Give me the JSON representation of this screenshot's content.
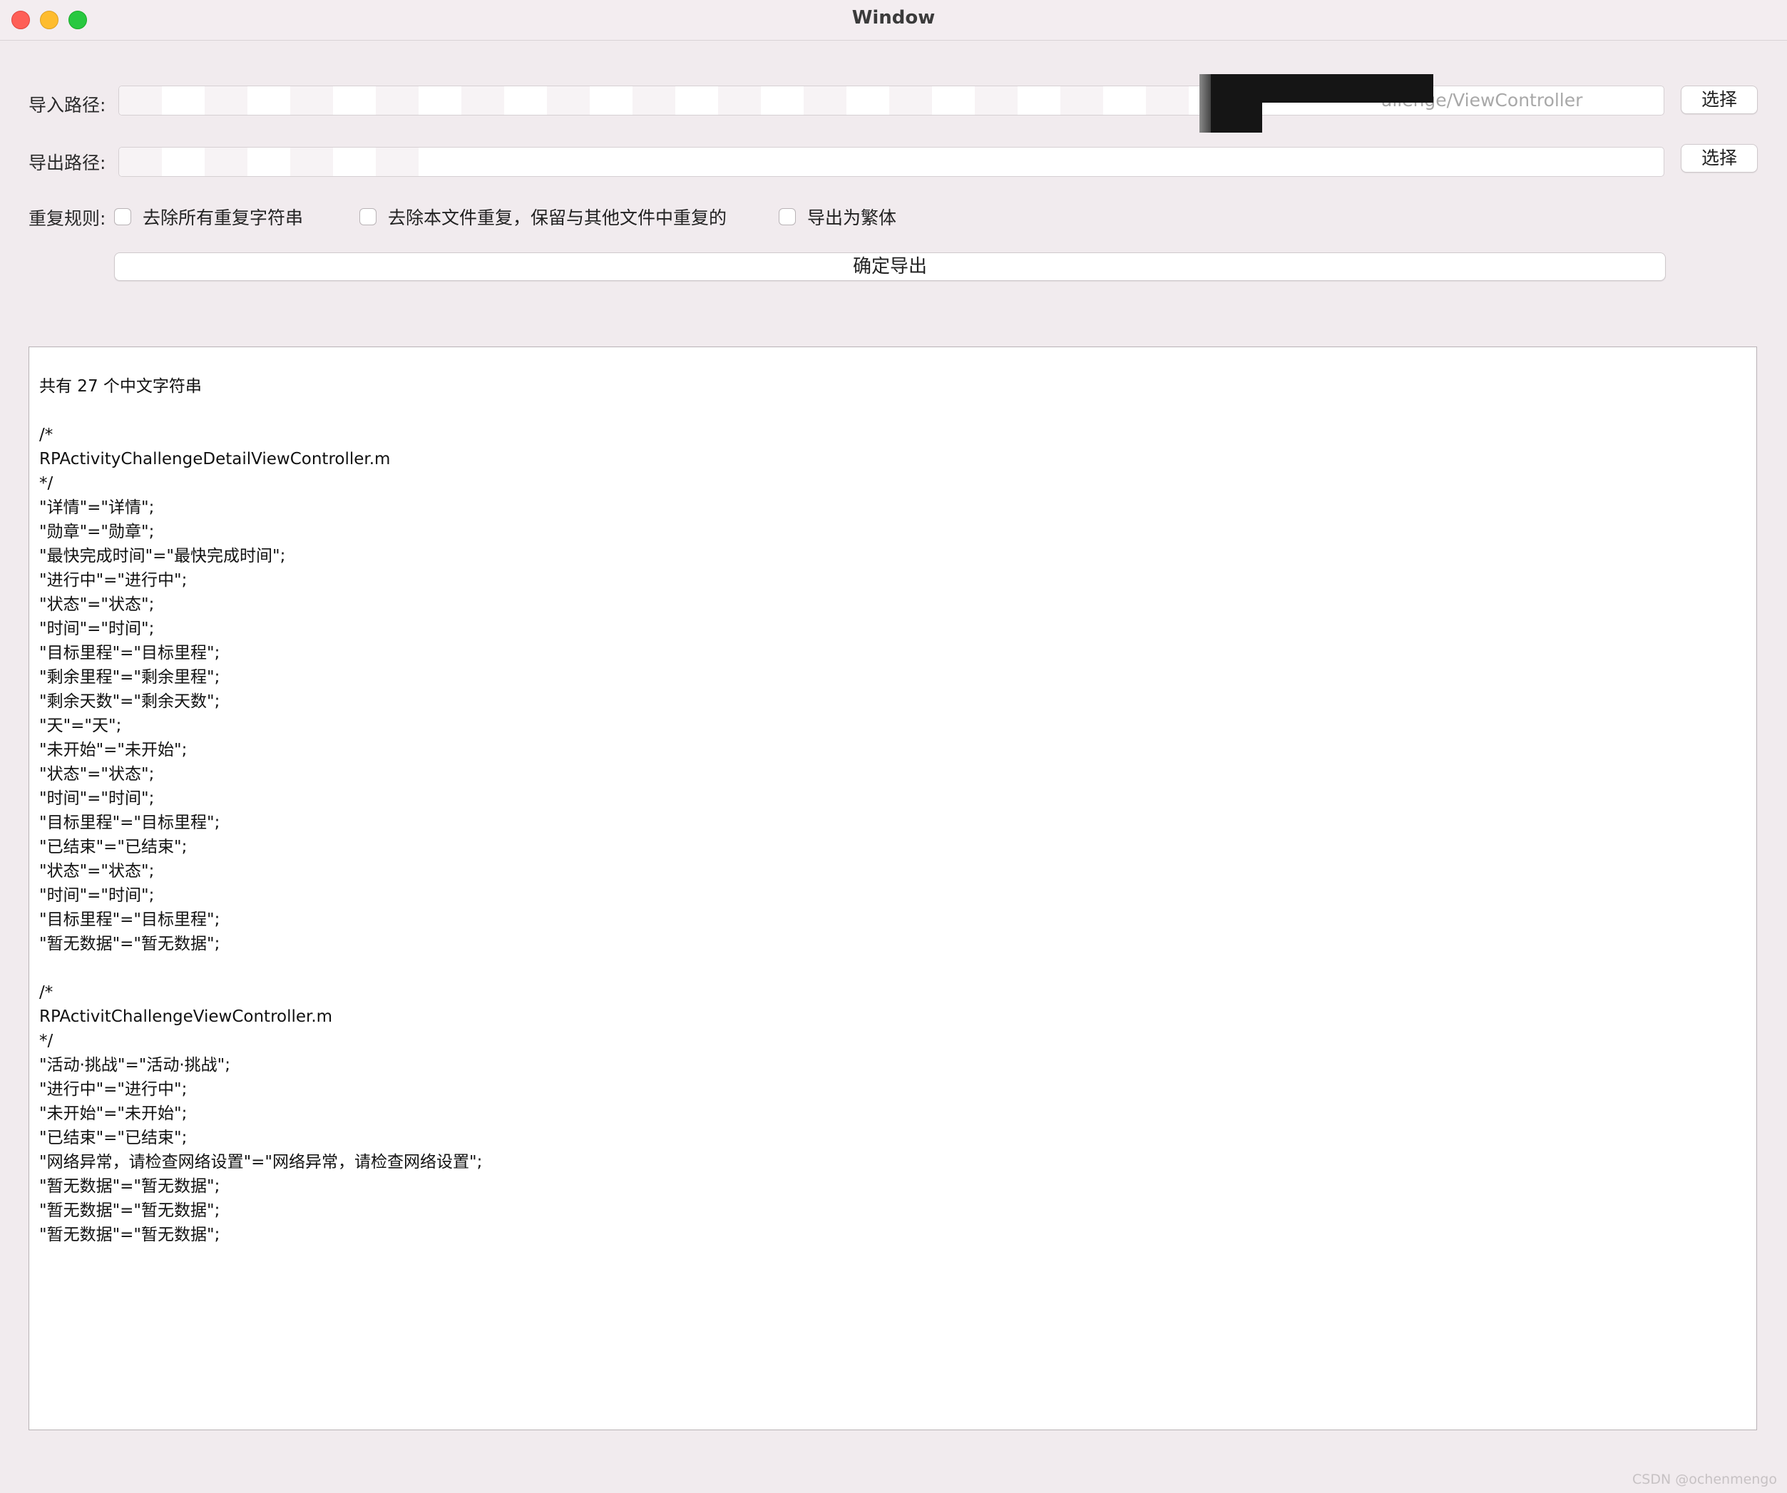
{
  "window": {
    "title": "Window"
  },
  "import_row": {
    "label": "导入路径:",
    "visible_path_tail": "allenge/ViewController",
    "button": "选择"
  },
  "export_row": {
    "label": "导出路径:",
    "button": "选择"
  },
  "rules": {
    "label": "重复规则:",
    "options": [
      {
        "label": "去除所有重复字符串",
        "checked": false
      },
      {
        "label": "去除本文件重复，保留与其他文件中重复的",
        "checked": false
      },
      {
        "label": "导出为繁体",
        "checked": false
      }
    ]
  },
  "confirm_button": "确定导出",
  "output": {
    "lines": [
      "共有 27 个中文字符串",
      "",
      "/*",
      "RPActivityChallengeDetailViewController.m",
      "*/",
      "\"详情\"=\"详情\";",
      "\"勋章\"=\"勋章\";",
      "\"最快完成时间\"=\"最快完成时间\";",
      "\"进行中\"=\"进行中\";",
      "\"状态\"=\"状态\";",
      "\"时间\"=\"时间\";",
      "\"目标里程\"=\"目标里程\";",
      "\"剩余里程\"=\"剩余里程\";",
      "\"剩余天数\"=\"剩余天数\";",
      "\"天\"=\"天\";",
      "\"未开始\"=\"未开始\";",
      "\"状态\"=\"状态\";",
      "\"时间\"=\"时间\";",
      "\"目标里程\"=\"目标里程\";",
      "\"已结束\"=\"已结束\";",
      "\"状态\"=\"状态\";",
      "\"时间\"=\"时间\";",
      "\"目标里程\"=\"目标里程\";",
      "\"暂无数据\"=\"暂无数据\";",
      "",
      "/*",
      "RPActivitChallengeViewController.m",
      "*/",
      "\"活动·挑战\"=\"活动·挑战\";",
      "\"进行中\"=\"进行中\";",
      "\"未开始\"=\"未开始\";",
      "\"已结束\"=\"已结束\";",
      "\"网络异常，请检查网络设置\"=\"网络异常，请检查网络设置\";",
      "\"暂无数据\"=\"暂无数据\";",
      "\"暂无数据\"=\"暂无数据\";",
      "\"暂无数据\"=\"暂无数据\";"
    ]
  },
  "watermark": "CSDN @ochenmengo"
}
